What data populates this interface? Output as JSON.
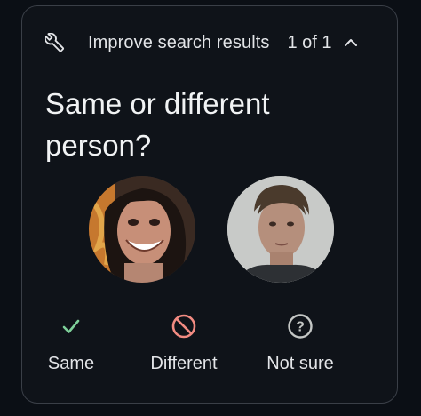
{
  "header": {
    "title": "Improve search results",
    "counter": "1 of 1",
    "icon": "wrench-icon",
    "collapse_icon": "chevron-up-icon"
  },
  "question": "Same or different person?",
  "images": [
    {
      "name": "face-image-1"
    },
    {
      "name": "face-image-2"
    }
  ],
  "actions": [
    {
      "label": "Same",
      "icon": "check-icon",
      "color": "#7ed09a"
    },
    {
      "label": "Different",
      "icon": "prohibited-icon",
      "color": "#f28b82"
    },
    {
      "label": "Not sure",
      "icon": "question-circle-icon",
      "color": "#c4c7c5"
    }
  ]
}
